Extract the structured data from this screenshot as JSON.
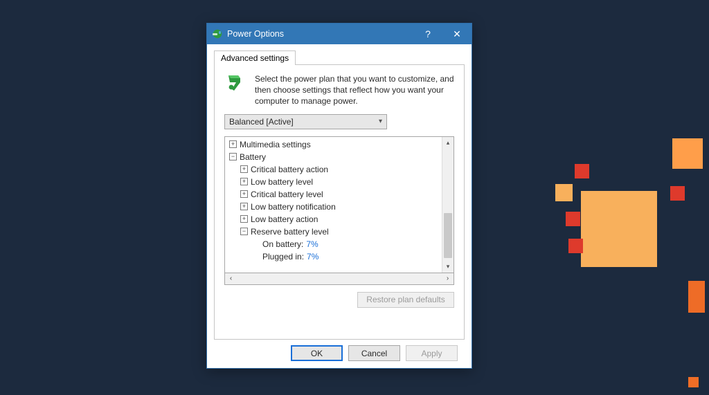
{
  "window": {
    "title": "Power Options",
    "help_label": "?",
    "close_label": "✕"
  },
  "tab": {
    "label": "Advanced settings"
  },
  "intro": "Select the power plan that you want to customize, and then choose settings that reflect how you want your computer to manage power.",
  "plan_combo": {
    "selected": "Balanced [Active]"
  },
  "tree": {
    "multimedia": "Multimedia settings",
    "battery": "Battery",
    "crit_action": "Critical battery action",
    "low_level": "Low battery level",
    "crit_level": "Critical battery level",
    "low_notif": "Low battery notification",
    "low_action": "Low battery action",
    "reserve": "Reserve battery level",
    "on_battery_label": "On battery:",
    "on_battery_value": "7%",
    "plugged_label": "Plugged in:",
    "plugged_value": "7%"
  },
  "buttons": {
    "restore": "Restore plan defaults",
    "ok": "OK",
    "cancel": "Cancel",
    "apply": "Apply"
  }
}
